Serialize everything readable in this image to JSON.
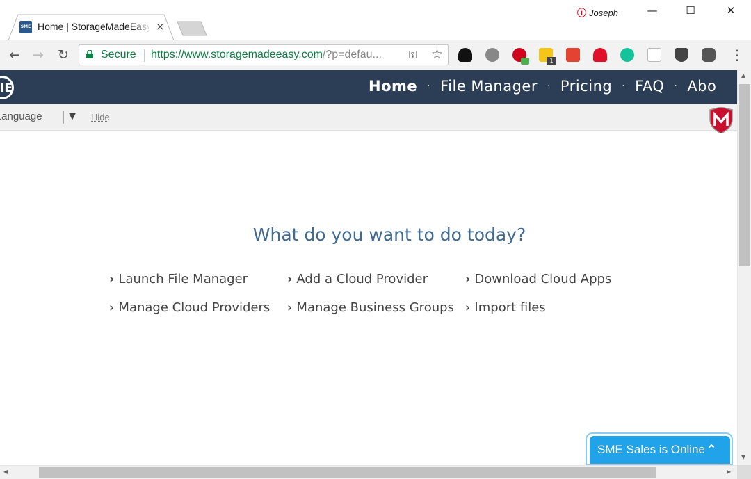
{
  "browser": {
    "tab": {
      "title": "Home | StorageMadeEasy",
      "favicon_text": "SME",
      "close_glyph": "×"
    },
    "profile": {
      "name": "Joseph",
      "icon_glyph": "ⓘ"
    },
    "window_controls": {
      "minimize": "—",
      "maximize": "☐",
      "close": "✕"
    },
    "nav": {
      "back": "←",
      "forward": "→",
      "reload": "↻"
    },
    "omnibox": {
      "secure_label": "Secure",
      "url_host": "https://www.storagemadeeasy.com",
      "url_path": "/?p=defau..."
    },
    "extensions": {
      "badge_count": "1"
    },
    "menu_glyph": "⋮"
  },
  "site": {
    "logo_text": "IE",
    "nav_links": [
      "Home",
      "File Manager",
      "Pricing",
      "FAQ",
      "Abo"
    ],
    "nav_separator": "·",
    "language_bar": {
      "select_label": "ct Language",
      "arrow": "▼",
      "hide_label": "Hide"
    },
    "headline": "What do you want to do today?",
    "actions": [
      "Launch File Manager",
      "Add a Cloud Provider",
      "Download Cloud Apps",
      "Manage Cloud Providers",
      "Manage Business Groups",
      "Import files"
    ],
    "chevron_glyph": "›",
    "chat": {
      "label": "SME Sales is Online",
      "arrow": "⌃"
    }
  },
  "scrollbars": {
    "up": "▲",
    "down": "▼",
    "left": "◀",
    "right": "▶"
  },
  "colors": {
    "nav_bg": "#2c3e55",
    "headline": "#3f6a91",
    "chat_bg": "#20a3e8",
    "secure_green": "#0b8043"
  }
}
